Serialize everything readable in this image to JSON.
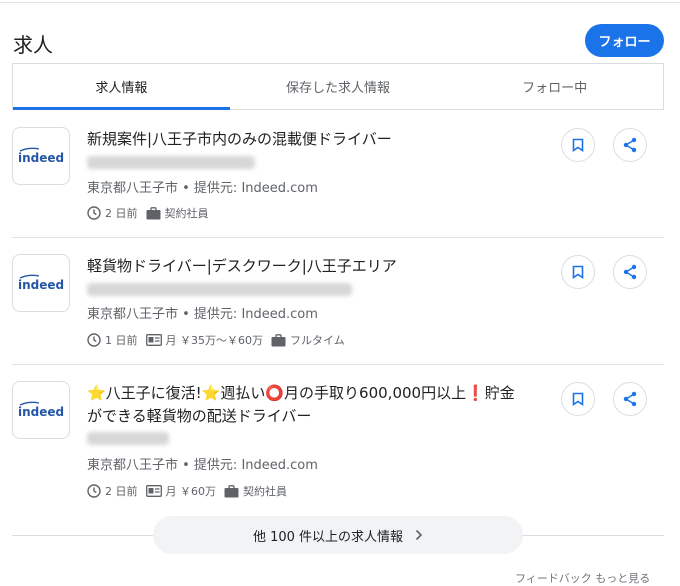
{
  "header": {
    "title": "求人",
    "follow_label": "フォロー"
  },
  "tabs": [
    {
      "label": "求人情報",
      "active": true
    },
    {
      "label": "保存した求人情報",
      "active": false
    },
    {
      "label": "フォロー中",
      "active": false
    }
  ],
  "jobs": [
    {
      "logo_text": "indeed",
      "title": "新規案件|八王子市内のみの混載便ドライバー",
      "location": "東京都八王子市 • 提供元: Indeed.com",
      "posted": "2 日前",
      "salary": "",
      "type": "契約社員"
    },
    {
      "logo_text": "indeed",
      "title": "軽貨物ドライバー|デスクワーク|八王子エリア",
      "location": "東京都八王子市 • 提供元: Indeed.com",
      "posted": "1 日前",
      "salary": "月 ￥35万～￥60万",
      "type": "フルタイム"
    },
    {
      "logo_text": "indeed",
      "title_line1": "⭐八王子に復活!⭐週払い⭕月の手取り600,000円以上❗貯金",
      "title_line2": "ができる軽貨物の配送ドライバー",
      "location": "東京都八王子市 • 提供元: Indeed.com",
      "posted": "2 日前",
      "salary": "月 ￥60万",
      "type": "契約社員"
    }
  ],
  "more_label": "他 100 件以上の求人情報",
  "footer": "フィードバック もっと見る",
  "colors": {
    "accent": "#1a73e8",
    "indeed_blue": "#2557a7"
  },
  "icons": [
    "bookmark-icon",
    "share-icon",
    "clock-icon",
    "briefcase-icon",
    "salary-icon",
    "chevron-right-icon"
  ]
}
